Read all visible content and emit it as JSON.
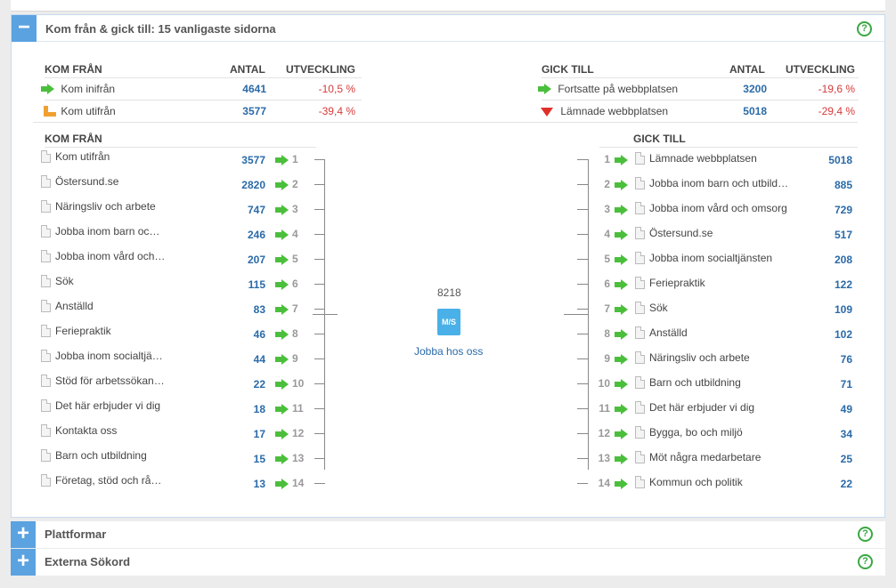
{
  "section1": {
    "title": "Kom från & gick till: 15 vanligaste sidorna",
    "help": "?",
    "toggle": "−"
  },
  "summary_left": {
    "h_from": "KOM FRÅN",
    "h_count": "ANTAL",
    "h_dev": "UTVECKLING",
    "rows": [
      {
        "icon": "green-arrow-icon",
        "label": "Kom inifrån",
        "count": "4641",
        "dev": "-10,5 %"
      },
      {
        "icon": "orange-arrow-icon",
        "label": "Kom utifrån",
        "count": "3577",
        "dev": "-39,4 %"
      }
    ]
  },
  "summary_right": {
    "h_to": "GICK TILL",
    "h_count": "ANTAL",
    "h_dev": "UTVECKLING",
    "rows": [
      {
        "icon": "green-arrow-icon",
        "label": "Fortsatte på webbplatsen",
        "count": "3200",
        "dev": "-19,6 %"
      },
      {
        "icon": "red-arrow-icon",
        "label": "Lämnade webbplatsen",
        "count": "5018",
        "dev": "-29,4 %"
      }
    ]
  },
  "from_title": "KOM FRÅN",
  "to_title": "GICK TILL",
  "from": [
    {
      "label": "Kom utifrån",
      "count": "3577",
      "rank": "1"
    },
    {
      "label": "Östersund.se",
      "count": "2820",
      "rank": "2"
    },
    {
      "label": "Näringsliv och arbete",
      "count": "747",
      "rank": "3"
    },
    {
      "label": "Jobba inom barn oc…",
      "count": "246",
      "rank": "4"
    },
    {
      "label": "Jobba inom vård och…",
      "count": "207",
      "rank": "5"
    },
    {
      "label": "Sök",
      "count": "115",
      "rank": "6"
    },
    {
      "label": "Anställd",
      "count": "83",
      "rank": "7"
    },
    {
      "label": "Feriepraktik",
      "count": "46",
      "rank": "8"
    },
    {
      "label": "Jobba inom socialtjä…",
      "count": "44",
      "rank": "9"
    },
    {
      "label": "Stöd för arbetssökan…",
      "count": "22",
      "rank": "10"
    },
    {
      "label": "Det här erbjuder vi dig",
      "count": "18",
      "rank": "11"
    },
    {
      "label": "Kontakta oss",
      "count": "17",
      "rank": "12"
    },
    {
      "label": "Barn och utbildning",
      "count": "15",
      "rank": "13"
    },
    {
      "label": "Företag, stöd och rå…",
      "count": "13",
      "rank": "14"
    }
  ],
  "to": [
    {
      "label": "Lämnade webbplatsen",
      "count": "5018",
      "rank": "1"
    },
    {
      "label": "Jobba inom barn och utbild…",
      "count": "885",
      "rank": "2"
    },
    {
      "label": "Jobba inom vård och omsorg",
      "count": "729",
      "rank": "3"
    },
    {
      "label": "Östersund.se",
      "count": "517",
      "rank": "4"
    },
    {
      "label": "Jobba inom socialtjänsten",
      "count": "208",
      "rank": "5"
    },
    {
      "label": "Feriepraktik",
      "count": "122",
      "rank": "6"
    },
    {
      "label": "Sök",
      "count": "109",
      "rank": "7"
    },
    {
      "label": "Anställd",
      "count": "102",
      "rank": "8"
    },
    {
      "label": "Näringsliv och arbete",
      "count": "76",
      "rank": "9"
    },
    {
      "label": "Barn och utbildning",
      "count": "71",
      "rank": "10"
    },
    {
      "label": "Det här erbjuder vi dig",
      "count": "49",
      "rank": "11"
    },
    {
      "label": "Bygga, bo och miljö",
      "count": "34",
      "rank": "12"
    },
    {
      "label": "Möt några medarbetare",
      "count": "25",
      "rank": "13"
    },
    {
      "label": "Kommun och politik",
      "count": "22",
      "rank": "14"
    }
  ],
  "center": {
    "count": "8218",
    "icon_text": "M/S",
    "label": "Jobba hos oss"
  },
  "section2": {
    "title": "Plattformar",
    "help": "?",
    "toggle": "+"
  },
  "section3": {
    "title": "Externa Sökord",
    "help": "?",
    "toggle": "+"
  }
}
